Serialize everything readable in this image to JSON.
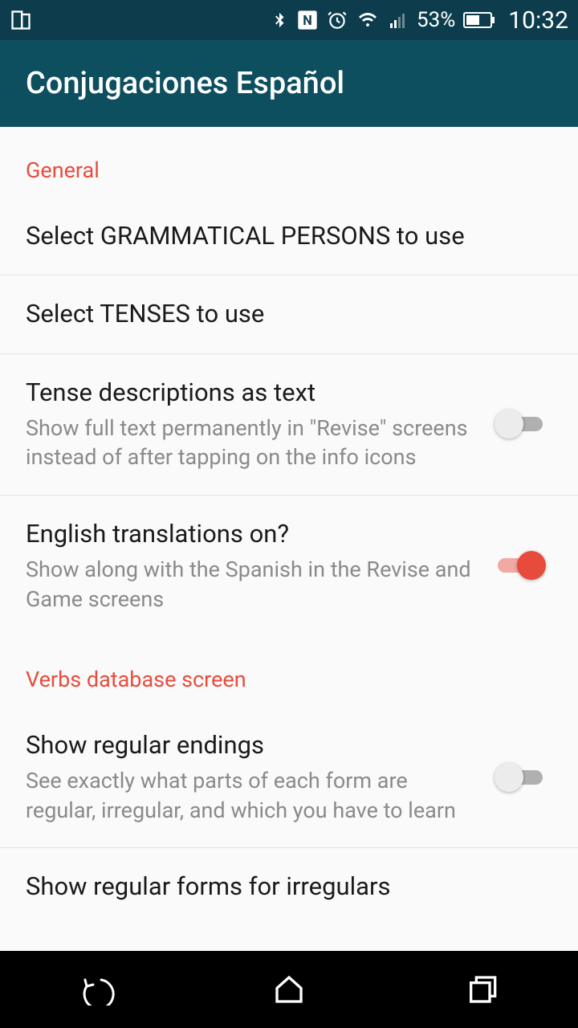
{
  "status": {
    "battery_pct": "53%",
    "time": "10:32"
  },
  "app": {
    "title": "Conjugaciones Español"
  },
  "sections": {
    "general": {
      "header": "General",
      "grammatical_persons": "Select GRAMMATICAL PERSONS to use",
      "tenses": "Select TENSES to use",
      "tense_desc_title": "Tense descriptions as text",
      "tense_desc_sub": "Show full text permanently in \"Revise\" screens instead of after tapping on the info icons",
      "translations_title": "English translations on?",
      "translations_sub": "Show along with the Spanish in the Revise and Game screens"
    },
    "verbs": {
      "header": "Verbs database screen",
      "regular_endings_title": "Show regular endings",
      "regular_endings_sub": "See exactly what parts of each form are regular, irregular, and which you have to learn",
      "regular_forms_title": "Show regular forms for irregulars"
    }
  }
}
